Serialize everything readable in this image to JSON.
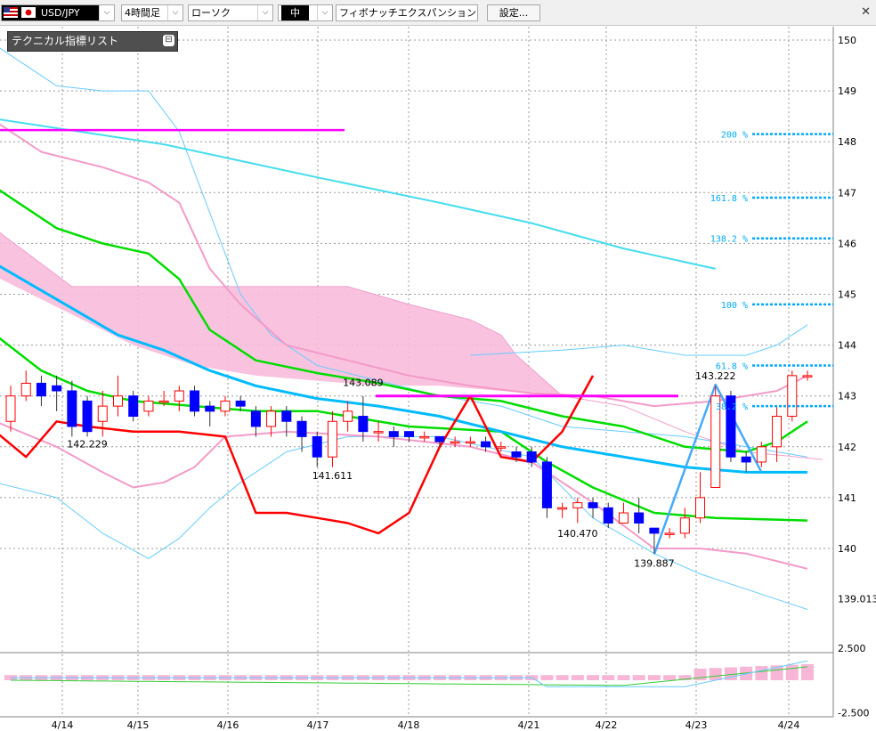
{
  "toolbar": {
    "pair": "USD/JPY",
    "timeframe": "4時間足",
    "chart_type": "ローソク",
    "line_width": "中",
    "drawing_tool": "フィボナッチエクスパンション",
    "settings_label": "設定..."
  },
  "panel": {
    "title": "テクニカル指標リスト"
  },
  "colors": {
    "bull": "#ff0000",
    "bear": "#0000ff",
    "cloud": "#f8bcdc",
    "ma_short": "#00dd00",
    "ma_mid": "#00bbff",
    "ma_long": "#44ddee",
    "bollinger_outer": "#f49ac8",
    "bollinger_far": "#66ccff",
    "chikou": "#ff0000",
    "hline": "#ff00ff",
    "fib": "#00aaff",
    "zigzag": "#44aaff"
  },
  "chart_data": {
    "type": "candlestick",
    "price_axis": {
      "min": 139.013,
      "max": 150,
      "ticks": [
        150,
        149,
        148,
        147,
        146,
        145,
        144,
        143,
        142,
        141,
        140
      ],
      "low_label": "139.013"
    },
    "date_labels": [
      "4/14",
      "4/15",
      "4/16",
      "4/17",
      "4/18",
      "4/21",
      "4/22",
      "4/23",
      "4/24"
    ],
    "fib_levels": [
      {
        "label": "200 %",
        "price": 148.15
      },
      {
        "label": "161.8 %",
        "price": 146.9
      },
      {
        "label": "138.2 %",
        "price": 146.1
      },
      {
        "label": "100 %",
        "price": 144.8
      },
      {
        "label": "61.8 %",
        "price": 143.6
      },
      {
        "label": "38.2 %",
        "price": 142.8
      }
    ],
    "annotations": [
      {
        "text": "142.229",
        "price": 142.229,
        "index": 5
      },
      {
        "text": "143.089",
        "price": 143.089,
        "index": 23
      },
      {
        "text": "141.611",
        "price": 141.611,
        "index": 21
      },
      {
        "text": "140.470",
        "price": 140.47,
        "index": 37
      },
      {
        "text": "139.887",
        "price": 139.887,
        "index": 42
      },
      {
        "text": "143.222",
        "price": 143.222,
        "index": 46
      }
    ],
    "candles": [
      [
        142.5,
        143.0,
        142.3,
        143.2
      ],
      [
        143.0,
        143.25,
        142.9,
        143.5
      ],
      [
        143.25,
        143.0,
        142.8,
        143.4
      ],
      [
        143.2,
        143.1,
        142.7,
        143.4
      ],
      [
        143.1,
        142.4,
        142.2,
        143.3
      ],
      [
        142.9,
        142.3,
        142.2,
        143.0
      ],
      [
        142.5,
        142.8,
        142.2,
        143.1
      ],
      [
        142.8,
        143.0,
        142.6,
        143.4
      ],
      [
        143.0,
        142.6,
        142.5,
        143.1
      ],
      [
        142.7,
        142.9,
        142.6,
        143.0
      ],
      [
        142.9,
        142.9,
        142.8,
        143.1
      ],
      [
        142.9,
        143.1,
        142.7,
        143.2
      ],
      [
        143.1,
        142.7,
        142.6,
        143.2
      ],
      [
        142.8,
        142.7,
        142.4,
        142.9
      ],
      [
        142.7,
        142.9,
        142.6,
        143.0
      ],
      [
        142.9,
        142.8,
        142.7,
        143.0
      ],
      [
        142.7,
        142.4,
        142.2,
        142.8
      ],
      [
        142.4,
        142.7,
        142.2,
        142.8
      ],
      [
        142.7,
        142.5,
        142.2,
        142.8
      ],
      [
        142.5,
        142.2,
        141.9,
        142.6
      ],
      [
        142.2,
        141.8,
        141.6,
        142.3
      ],
      [
        141.8,
        142.5,
        141.6,
        142.7
      ],
      [
        142.5,
        142.7,
        142.3,
        142.9
      ],
      [
        142.6,
        142.3,
        142.1,
        143.0
      ],
      [
        142.3,
        142.3,
        142.1,
        142.5
      ],
      [
        142.3,
        142.2,
        142.0,
        142.4
      ],
      [
        142.3,
        142.2,
        142.1,
        142.3
      ],
      [
        142.2,
        142.2,
        142.1,
        142.3
      ],
      [
        142.2,
        142.1,
        142.0,
        142.2
      ],
      [
        142.1,
        142.1,
        142.0,
        142.2
      ],
      [
        142.1,
        142.1,
        142.0,
        142.2
      ],
      [
        142.1,
        142.0,
        141.9,
        142.2
      ],
      [
        142.0,
        142.0,
        141.9,
        142.1
      ],
      [
        141.9,
        141.8,
        141.7,
        142.0
      ],
      [
        141.9,
        141.7,
        141.6,
        142.0
      ],
      [
        141.7,
        140.8,
        140.6,
        141.8
      ],
      [
        140.8,
        140.8,
        140.6,
        140.9
      ],
      [
        140.8,
        140.9,
        140.5,
        141.0
      ],
      [
        140.9,
        140.8,
        140.6,
        141.0
      ],
      [
        140.8,
        140.5,
        140.4,
        140.9
      ],
      [
        140.5,
        140.7,
        140.5,
        140.9
      ],
      [
        140.7,
        140.5,
        140.3,
        141.0
      ],
      [
        140.4,
        140.3,
        139.9,
        140.4
      ],
      [
        140.3,
        140.3,
        140.2,
        140.4
      ],
      [
        140.3,
        140.6,
        140.2,
        140.8
      ],
      [
        140.6,
        141.0,
        140.5,
        141.5
      ],
      [
        141.2,
        143.0,
        141.2,
        143.2
      ],
      [
        143.0,
        141.8,
        141.7,
        143.1
      ],
      [
        141.8,
        141.7,
        141.5,
        141.9
      ],
      [
        141.7,
        142.0,
        141.6,
        142.1
      ],
      [
        142.0,
        142.6,
        141.7,
        142.8
      ],
      [
        142.6,
        143.4,
        142.5,
        143.5
      ],
      [
        143.4,
        143.4,
        143.3,
        143.5
      ]
    ],
    "oscillator": {
      "ticks": [
        2.5,
        -2.5
      ]
    }
  }
}
